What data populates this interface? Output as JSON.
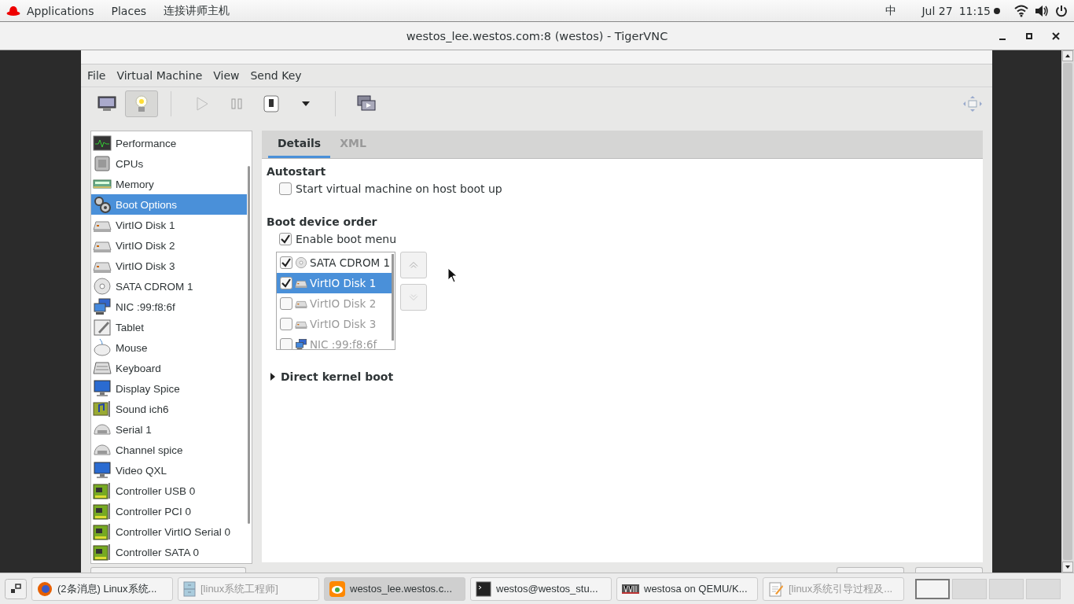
{
  "top_bar": {
    "menus": [
      "Applications",
      "Places",
      "连接讲师主机"
    ],
    "input_method": "中",
    "date": "Jul 27",
    "time": "11:15"
  },
  "vnc_window": {
    "title": "westos_lee.westos.com:8 (westos) - TigerVNC"
  },
  "menu_bar": [
    "File",
    "Virtual Machine",
    "View",
    "Send Key"
  ],
  "toolbar": [
    {
      "kind": "console",
      "selected": false
    },
    {
      "kind": "details",
      "selected": true
    },
    {
      "kind": "run",
      "selected": false
    },
    {
      "kind": "pause",
      "selected": false
    },
    {
      "kind": "shutdown",
      "selected": false
    },
    {
      "kind": "dropdown",
      "selected": false
    },
    {
      "kind": "snapshots",
      "selected": false
    }
  ],
  "sidebar": {
    "items": [
      {
        "kind": "performance",
        "label": "Performance",
        "selected": false
      },
      {
        "kind": "cpu",
        "label": "CPUs",
        "selected": false
      },
      {
        "kind": "memory",
        "label": "Memory",
        "selected": false
      },
      {
        "kind": "boot",
        "label": "Boot Options",
        "selected": true
      },
      {
        "kind": "disk",
        "label": "VirtIO Disk 1",
        "selected": false
      },
      {
        "kind": "disk",
        "label": "VirtIO Disk 2",
        "selected": false
      },
      {
        "kind": "disk",
        "label": "VirtIO Disk 3",
        "selected": false
      },
      {
        "kind": "cdrom",
        "label": "SATA CDROM 1",
        "selected": false
      },
      {
        "kind": "nic",
        "label": "NIC :99:f8:6f",
        "selected": false
      },
      {
        "kind": "tablet",
        "label": "Tablet",
        "selected": false
      },
      {
        "kind": "mouse",
        "label": "Mouse",
        "selected": false
      },
      {
        "kind": "keyboard",
        "label": "Keyboard",
        "selected": false
      },
      {
        "kind": "display",
        "label": "Display Spice",
        "selected": false
      },
      {
        "kind": "sound",
        "label": "Sound ich6",
        "selected": false
      },
      {
        "kind": "serial",
        "label": "Serial 1",
        "selected": false
      },
      {
        "kind": "serial",
        "label": "Channel spice",
        "selected": false
      },
      {
        "kind": "display",
        "label": "Video QXL",
        "selected": false
      },
      {
        "kind": "controller",
        "label": "Controller USB 0",
        "selected": false
      },
      {
        "kind": "controller",
        "label": "Controller PCI 0",
        "selected": false
      },
      {
        "kind": "controller",
        "label": "Controller VirtIO Serial 0",
        "selected": false
      },
      {
        "kind": "controller",
        "label": "Controller SATA 0",
        "selected": false
      }
    ]
  },
  "tabs": [
    {
      "label": "Details",
      "selected": true
    },
    {
      "label": "XML",
      "selected": false
    }
  ],
  "autostart": {
    "heading": "Autostart",
    "option": {
      "label": "Start virtual machine on host boot up",
      "checked": false
    }
  },
  "boot_order": {
    "heading": "Boot device order",
    "enable_menu": {
      "label": "Enable boot menu",
      "checked": true
    },
    "devices": [
      {
        "kind": "cdrom",
        "label": "SATA CDROM 1",
        "checked": true,
        "selected": false
      },
      {
        "kind": "disk",
        "label": "VirtIO Disk 1",
        "checked": true,
        "selected": true
      },
      {
        "kind": "disk",
        "label": "VirtIO Disk 2",
        "checked": false,
        "selected": false
      },
      {
        "kind": "disk",
        "label": "VirtIO Disk 3",
        "checked": false,
        "selected": false
      },
      {
        "kind": "nic",
        "label": "NIC :99:f8:6f",
        "checked": false,
        "selected": false
      }
    ]
  },
  "direct_kernel_boot": {
    "label": "Direct kernel boot",
    "expanded": false
  },
  "taskbar": {
    "items": [
      {
        "kind": "firefox",
        "label": "(2条消息) Linux系统...",
        "selected": false,
        "dimmed": false
      },
      {
        "kind": "files",
        "label": "[linux系统工程师]",
        "selected": false,
        "dimmed": true
      },
      {
        "kind": "vnc",
        "label": "westos_lee.westos.c...",
        "selected": true,
        "dimmed": false
      },
      {
        "kind": "terminal",
        "label": "westos@westos_stu...",
        "selected": false,
        "dimmed": false
      },
      {
        "kind": "vmm",
        "label": "westosa on QEMU/K...",
        "selected": false,
        "dimmed": false
      },
      {
        "kind": "editor",
        "label": "[linux系统引导过程及...",
        "selected": false,
        "dimmed": true
      }
    ],
    "workspaces": [
      {
        "selected": true
      },
      {
        "selected": false
      },
      {
        "selected": false
      },
      {
        "selected": false
      }
    ]
  }
}
